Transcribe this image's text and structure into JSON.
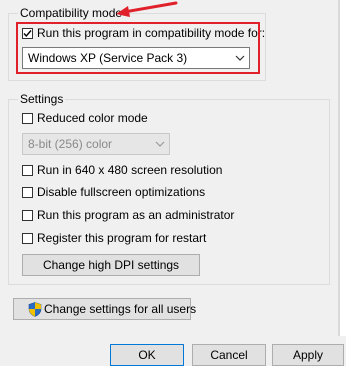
{
  "compat": {
    "group_label": "Compatibility mode",
    "run_compat_label": "Run this program in compatibility mode for:",
    "run_compat_checked": true,
    "os_selected": "Windows XP (Service Pack 3)"
  },
  "settings": {
    "group_label": "Settings",
    "reduced_color_label": "Reduced color mode",
    "color_mode_selected": "8-bit (256) color",
    "res_640_label": "Run in 640 x 480 screen resolution",
    "disable_fullscreen_label": "Disable fullscreen optimizations",
    "run_admin_label": "Run this program as an administrator",
    "register_restart_label": "Register this program for restart",
    "dpi_button": "Change high DPI settings"
  },
  "all_users_button": "Change settings for all users",
  "buttons": {
    "ok": "OK",
    "cancel": "Cancel",
    "apply": "Apply"
  },
  "colors": {
    "highlight_red": "#e0202a",
    "panel_bg": "#f0f0f0",
    "shield_blue": "#2b6cc4",
    "shield_yellow": "#f2c200"
  }
}
